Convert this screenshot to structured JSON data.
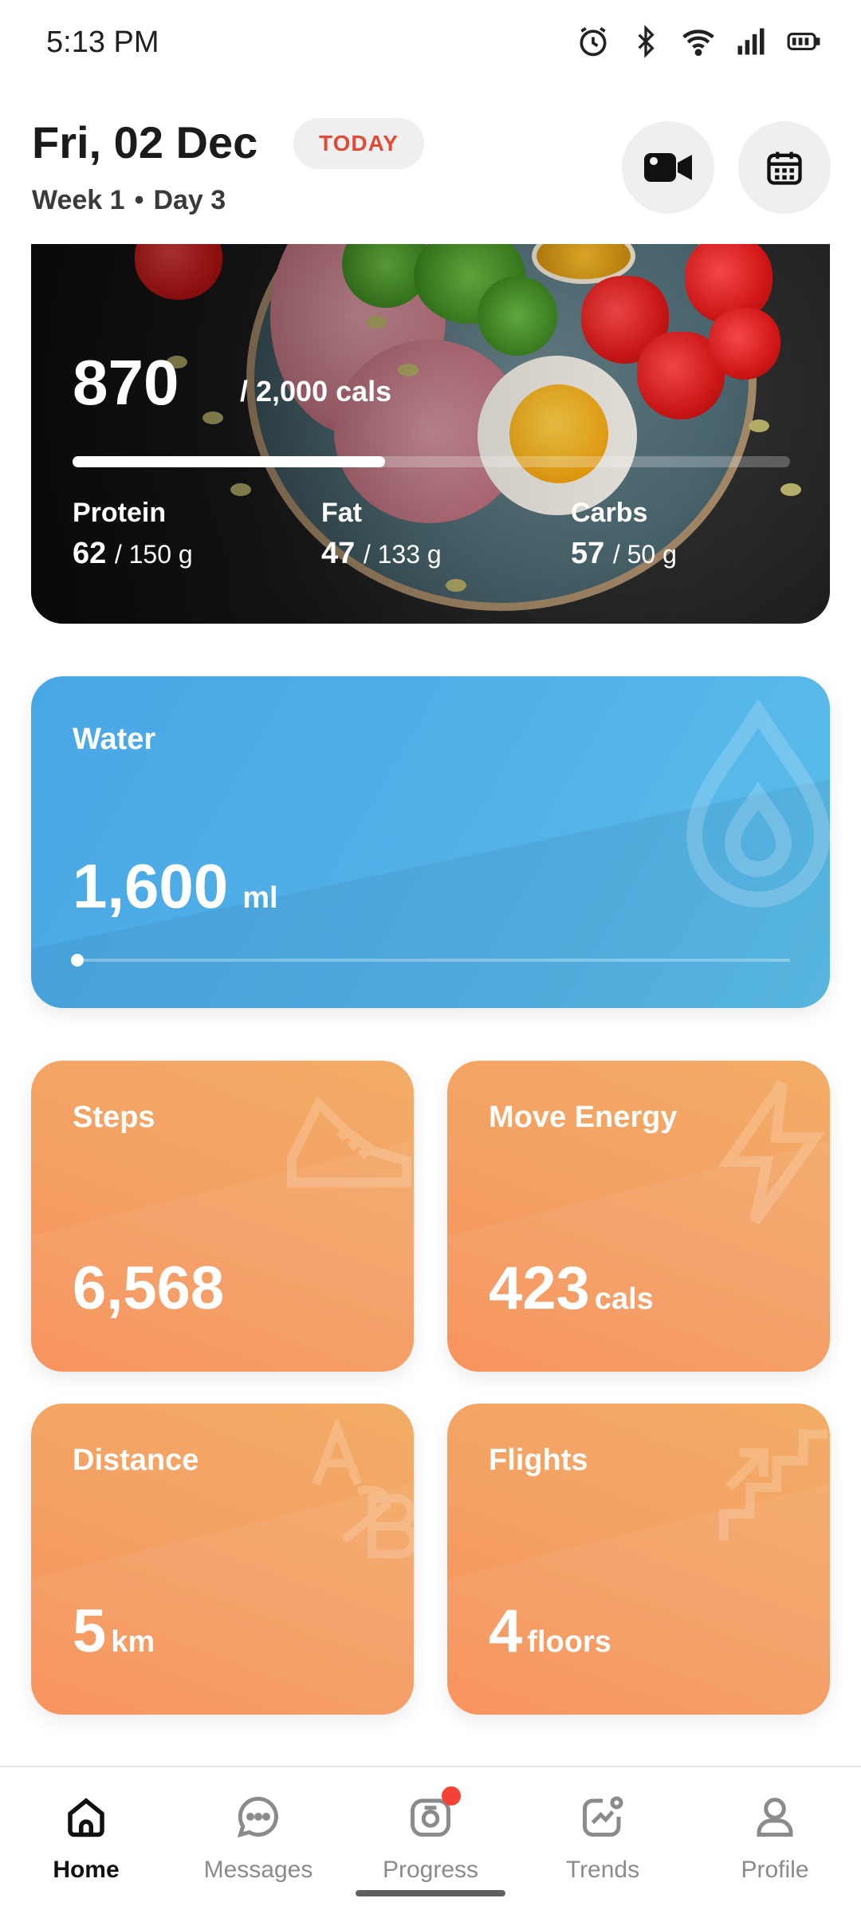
{
  "status_bar": {
    "time": "5:13 PM",
    "icons": [
      "alarm-icon",
      "bluetooth-icon",
      "wifi-icon",
      "signal-icon",
      "battery-icon"
    ]
  },
  "header": {
    "date": "Fri, 02 Dec",
    "today_badge": "TODAY",
    "week": "Week 1",
    "separator": "•",
    "day": "Day 3",
    "actions": [
      "video-camera-icon",
      "calendar-icon"
    ]
  },
  "calories": {
    "consumed": "870",
    "goal_text": "/ 2,000 cals",
    "progress": 0.435,
    "macros": [
      {
        "label": "Protein",
        "value": "62",
        "target": "/ 150 g"
      },
      {
        "label": "Fat",
        "value": "47",
        "target": "/ 133 g"
      },
      {
        "label": "Carbs",
        "value": "57",
        "target": "/ 50 g"
      }
    ]
  },
  "water": {
    "title": "Water",
    "value": "1,600",
    "unit": "ml",
    "progress": 0.0
  },
  "tiles": {
    "steps": {
      "title": "Steps",
      "value": "6,568",
      "unit": ""
    },
    "energy": {
      "title": "Move Energy",
      "value": "423",
      "unit": "cals"
    },
    "distance": {
      "title": "Distance",
      "value": "5",
      "unit": "km"
    },
    "flights": {
      "title": "Flights",
      "value": "4",
      "unit": "floors"
    }
  },
  "nav": {
    "items": [
      {
        "label": "Home",
        "icon": "home-icon",
        "active": true
      },
      {
        "label": "Messages",
        "icon": "chat-icon",
        "active": false
      },
      {
        "label": "Progress",
        "icon": "camera-icon",
        "active": false,
        "badge": true
      },
      {
        "label": "Trends",
        "icon": "trend-chart-icon",
        "active": false
      },
      {
        "label": "Profile",
        "icon": "user-icon",
        "active": false
      }
    ]
  },
  "colors": {
    "today_text": "#e24a38",
    "water_bg": "#53b1e7",
    "tile_bg": "#f4a064",
    "badge": "#f44336"
  }
}
